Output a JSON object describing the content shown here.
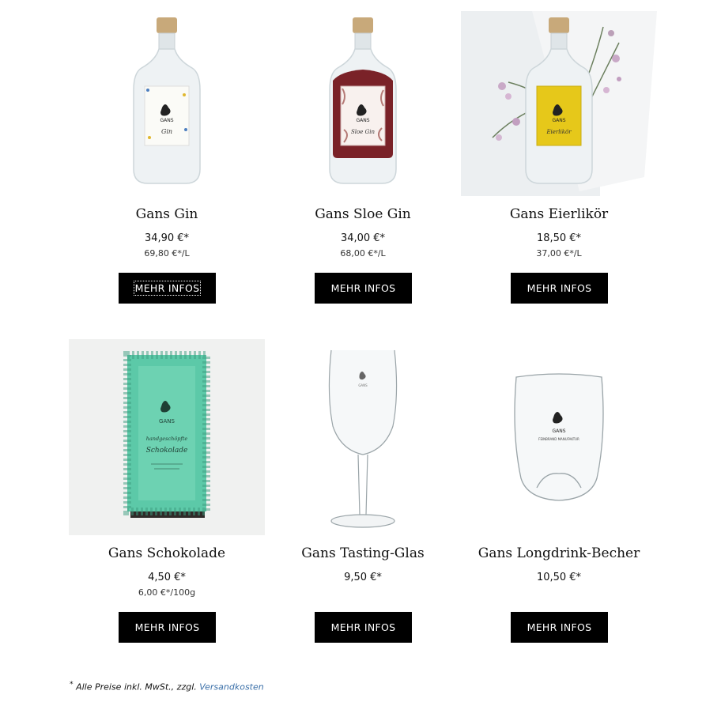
{
  "products": [
    {
      "name": "Gans Gin",
      "price": "34,90 €*",
      "unit_price": "69,80 €*/L",
      "button": "MEHR INFOS"
    },
    {
      "name": "Gans Sloe Gin",
      "price": "34,00 €*",
      "unit_price": "68,00 €*/L",
      "button": "MEHR INFOS"
    },
    {
      "name": "Gans Eierlikör",
      "price": "18,50 €*",
      "unit_price": "37,00 €*/L",
      "button": "MEHR INFOS"
    },
    {
      "name": "Gans Schokolade",
      "price": "4,50 €*",
      "unit_price": "6,00 €*/100g",
      "button": "MEHR INFOS"
    },
    {
      "name": "Gans Tasting-Glas",
      "price": "9,50 €*",
      "unit_price": "",
      "button": "MEHR INFOS"
    },
    {
      "name": "Gans Longdrink-Becher",
      "price": "10,50 €*",
      "unit_price": "",
      "button": "MEHR INFOS"
    }
  ],
  "labels": {
    "brand": "GANS",
    "gin_script": "Gin",
    "sloe_script": "Sloe Gin",
    "eier_script": "Eierlikör",
    "choc_script1": "handgeschöpfte",
    "choc_script2": "Schokolade",
    "glass_sub": "FEINBRAND MANUFAKTUR"
  },
  "footnote": {
    "star": "*",
    "text": " Alle Preise inkl. MwSt., zzgl. ",
    "link": "Versandkosten"
  },
  "colors": {
    "button_bg": "#000000",
    "link": "#3a6fa8",
    "sloe_liquid": "#7a2228",
    "eier_label": "#e6c81a",
    "choc_wrapper": "#5cc9a8"
  }
}
